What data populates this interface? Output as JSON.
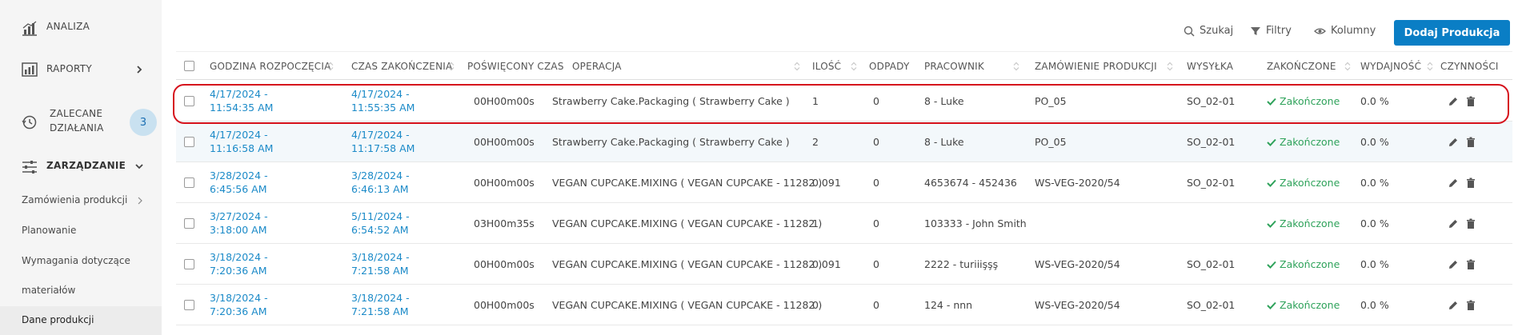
{
  "sidebar": {
    "analiza": "ANALIZA",
    "raporty": "RAPORTY",
    "zalecane_line1": "ZALECANE",
    "zalecane_line2": "DZIAŁANIA",
    "zalecane_badge": "3",
    "zarzadzanie": "ZARZĄDZANIE",
    "sub_items": [
      "Zamówienia produkcji",
      "Planowanie",
      "Wymagania dotyczące",
      "materiałów",
      "Dane produkcji"
    ]
  },
  "toolbar": {
    "search": "Szukaj",
    "filters": "Filtry",
    "columns": "Kolumny",
    "add": "Dodaj Produkcja"
  },
  "columns": [
    "GODZINA ROZPOCZĘCIA",
    "CZAS ZAKOŃCZENIA",
    "POŚWIĘCONY CZAS",
    "OPERACJA",
    "ILOŚĆ",
    "ODPADY",
    "PRACOWNIK",
    "ZAMÓWIENIE PRODUKCJI",
    "WYSYŁKA",
    "ZAKOŃCZONE",
    "WYDAJNOŚĆ",
    "CZYNNOŚCI"
  ],
  "rows": [
    {
      "start1": "4/17/2024 -",
      "start2": "11:54:35 AM",
      "end1": "4/17/2024 -",
      "end2": "11:55:35 AM",
      "time": "00H00m00s",
      "op": "Strawberry Cake.Packaging ( Strawberry Cake )",
      "qty": "1",
      "waste": "0",
      "worker": "8 - Luke",
      "order": "PO_05",
      "ship": "SO_02-01",
      "done": "Zakończone",
      "eff": "0.0 %"
    },
    {
      "start1": "4/17/2024 -",
      "start2": "11:16:58 AM",
      "end1": "4/17/2024 -",
      "end2": "11:17:58 AM",
      "time": "00H00m00s",
      "op": "Strawberry Cake.Packaging ( Strawberry Cake )",
      "qty": "2",
      "waste": "0",
      "worker": "8 - Luke",
      "order": "PO_05",
      "ship": "SO_02-01",
      "done": "Zakończone",
      "eff": "0.0 %"
    },
    {
      "start1": "3/28/2024 -",
      "start2": "6:45:56 AM",
      "end1": "3/28/2024 -",
      "end2": "6:46:13 AM",
      "time": "00H00m00s",
      "op": "VEGAN CUPCAKE.MIXING ( VEGAN CUPCAKE - 11282 )",
      "qty": "0.091",
      "waste": "0",
      "worker": "4653674 - 452436",
      "order": "WS-VEG-2020/54",
      "ship": "SO_02-01",
      "done": "Zakończone",
      "eff": "0.0 %"
    },
    {
      "start1": "3/27/2024 -",
      "start2": "3:18:00 AM",
      "end1": "5/11/2024 -",
      "end2": "6:54:52 AM",
      "time": "03H00m35s",
      "op": "VEGAN CUPCAKE.MIXING ( VEGAN CUPCAKE - 11282 )",
      "qty": "1",
      "waste": "0",
      "worker": "103333 - John Smith",
      "order": "",
      "ship": "",
      "done": "Zakończone",
      "eff": "0.0 %"
    },
    {
      "start1": "3/18/2024 -",
      "start2": "7:20:36 AM",
      "end1": "3/18/2024 -",
      "end2": "7:21:58 AM",
      "time": "00H00m00s",
      "op": "VEGAN CUPCAKE.MIXING ( VEGAN CUPCAKE - 11282 )",
      "qty": "0.091",
      "waste": "0",
      "worker": "2222 - turiiişşş",
      "order": "WS-VEG-2020/54",
      "ship": "SO_02-01",
      "done": "Zakończone",
      "eff": "0.0 %"
    },
    {
      "start1": "3/18/2024 -",
      "start2": "7:20:36 AM",
      "end1": "3/18/2024 -",
      "end2": "7:21:58 AM",
      "time": "00H00m00s",
      "op": "VEGAN CUPCAKE.MIXING ( VEGAN CUPCAKE - 11282 )",
      "qty": "0",
      "waste": "0",
      "worker": "124 - nnn",
      "order": "WS-VEG-2020/54",
      "ship": "SO_02-01",
      "done": "Zakończone",
      "eff": "0.0 %"
    }
  ],
  "colors": {
    "accent": "#0a7ec5",
    "link": "#1b8ac8",
    "success": "#2ea25a",
    "highlight": "#d6121c"
  },
  "icons": {
    "analiza": "bar-chart-icon",
    "raporty": "report-icon",
    "zalecane": "history-icon",
    "zarzadzanie": "sliders-icon"
  }
}
